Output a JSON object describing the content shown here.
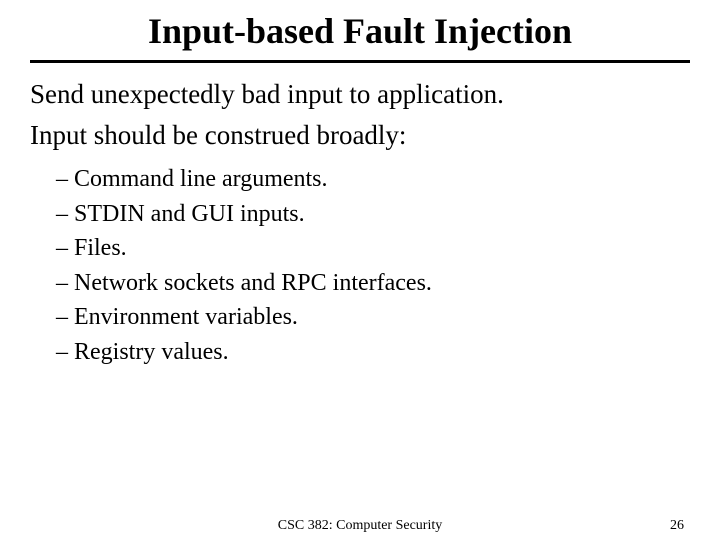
{
  "title": "Input-based Fault Injection",
  "intro_line1": "Send unexpectedly bad input to application.",
  "intro_line2": "Input should be construed broadly:",
  "bullets": {
    "b0": "Command line arguments.",
    "b1": "STDIN and GUI inputs.",
    "b2": "Files.",
    "b3": "Network sockets and RPC interfaces.",
    "b4": "Environment variables.",
    "b5": "Registry values."
  },
  "footer": {
    "course": "CSC 382: Computer Security",
    "page": "26"
  }
}
